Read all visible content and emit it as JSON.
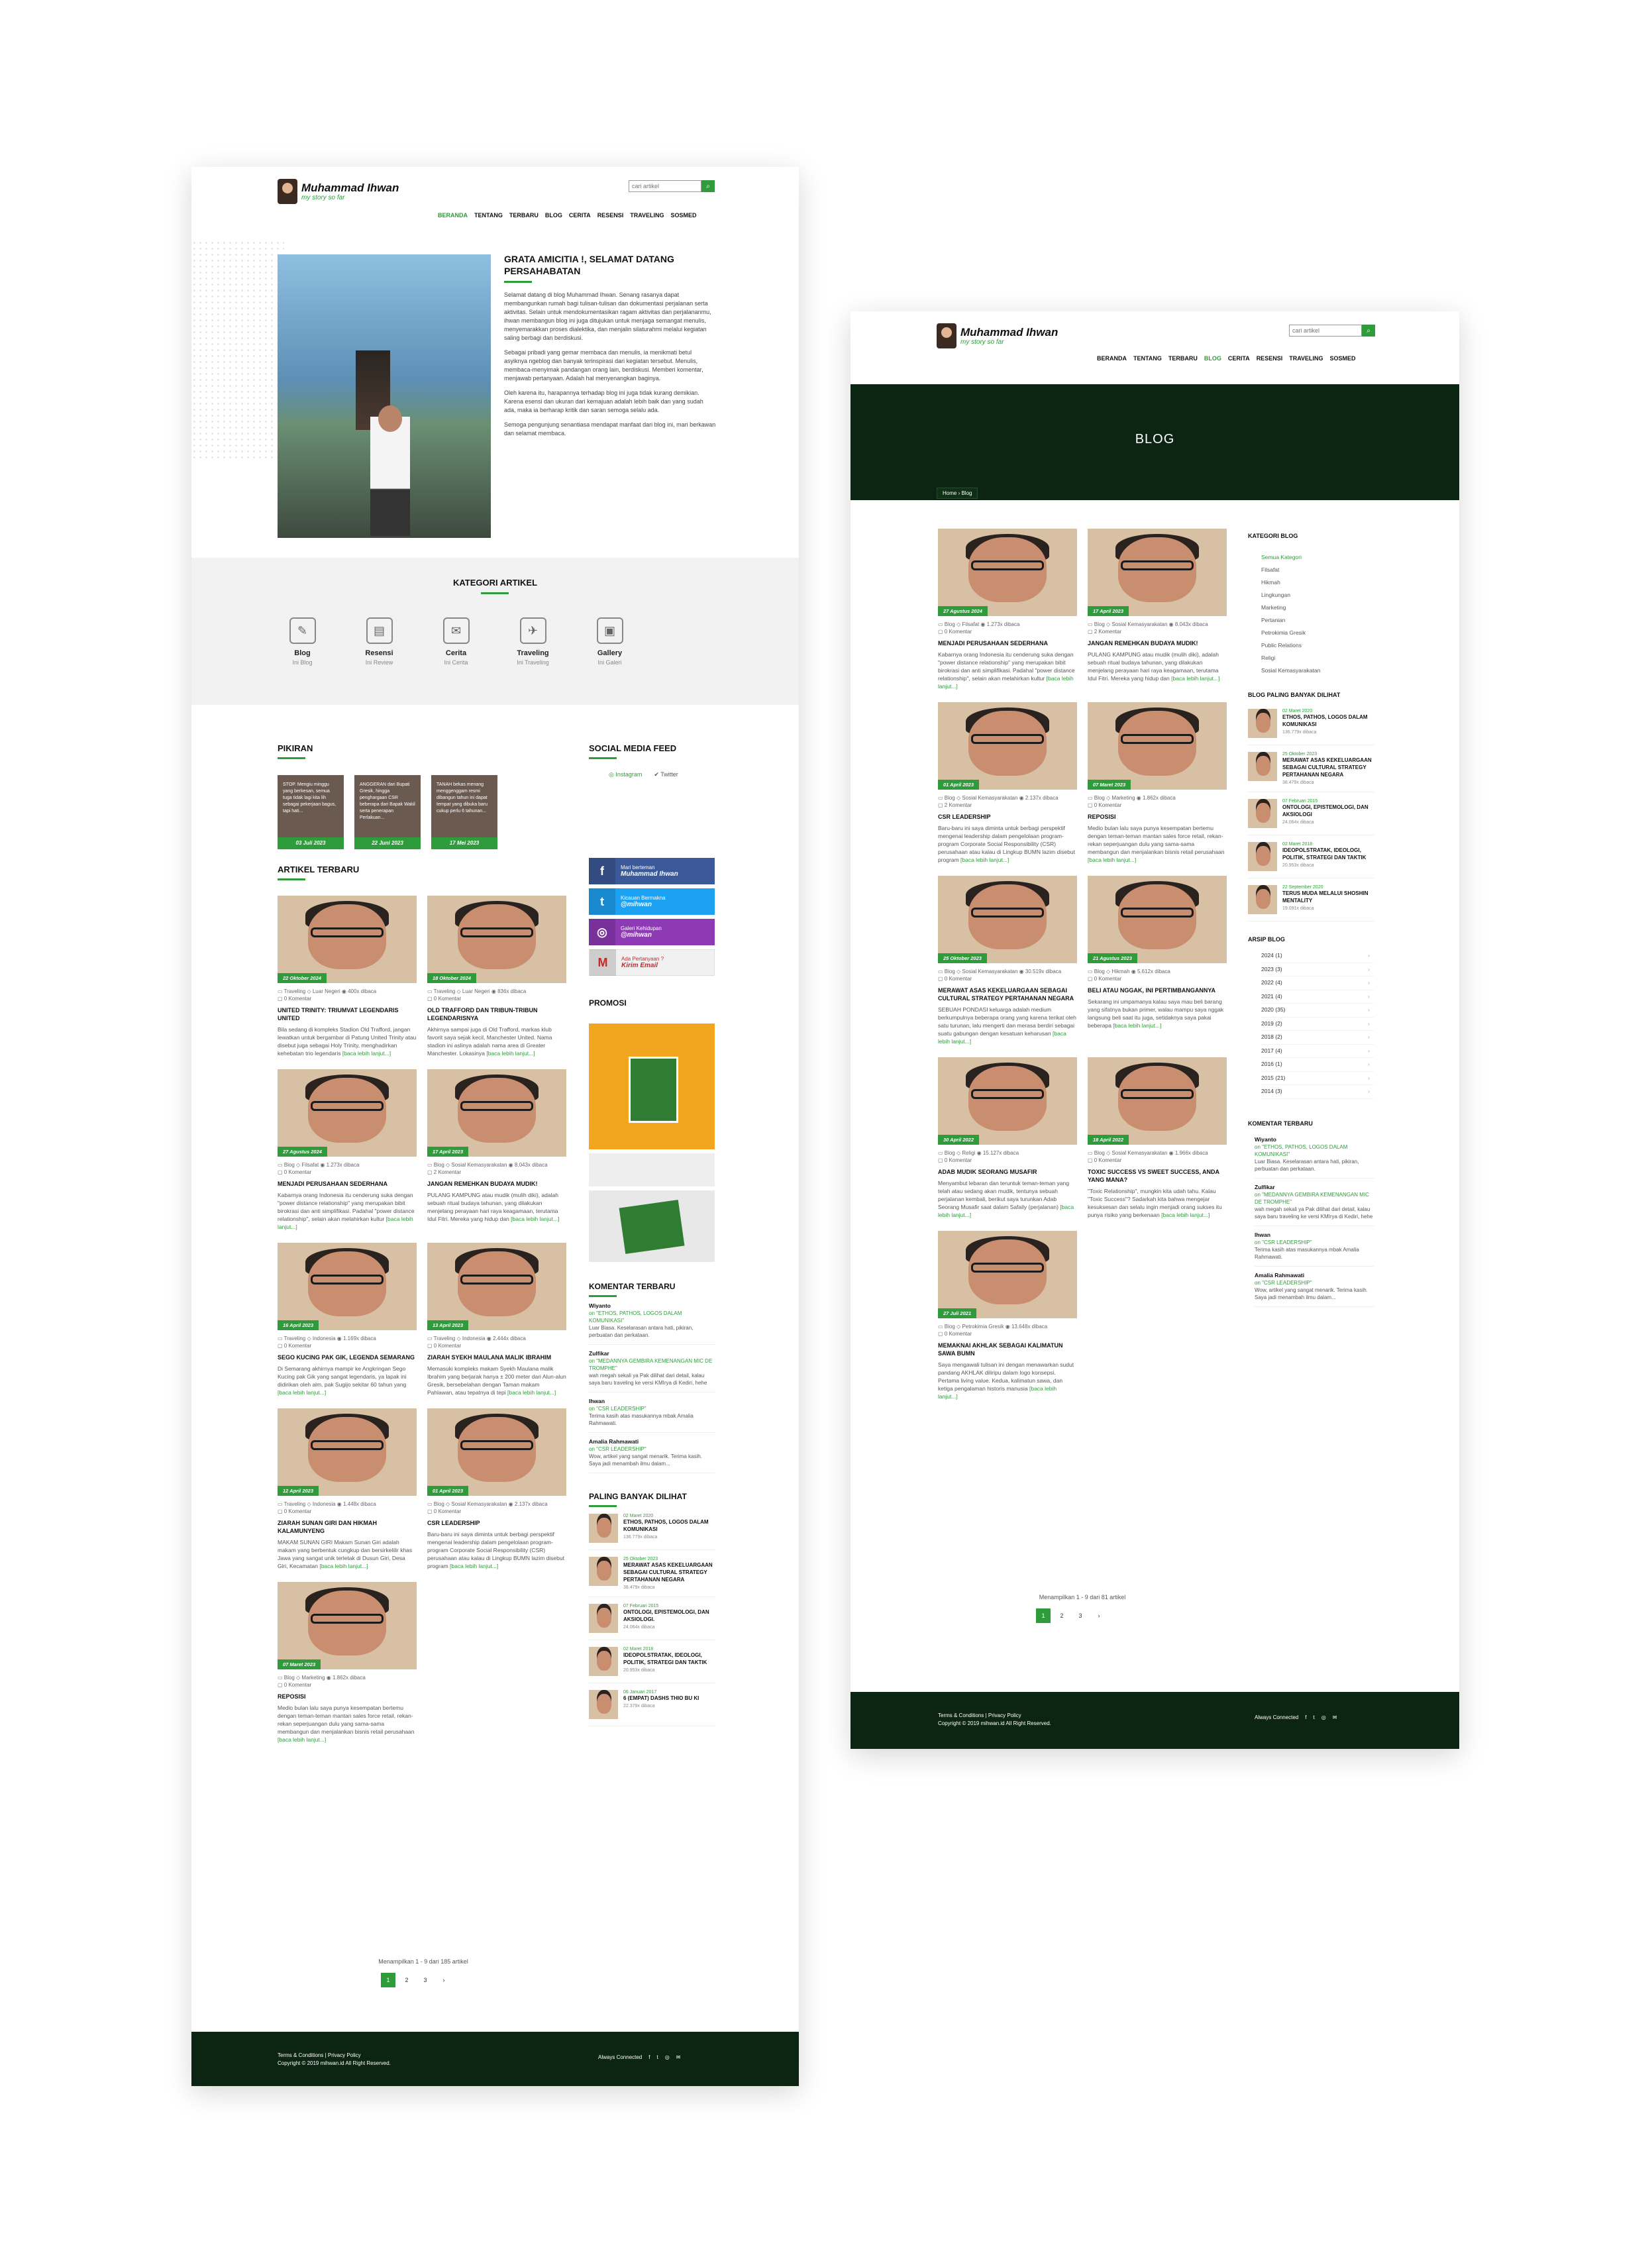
{
  "site": {
    "name": "Muhammad Ihwan",
    "tagline": "my story so far",
    "search_placeholder": "cari artikel",
    "nav": [
      "BERANDA",
      "TENTANG",
      "TERBARU",
      "BLOG",
      "CERITA",
      "RESENSI",
      "TRAVELING",
      "SOSMED"
    ]
  },
  "home": {
    "intro_title": "GRATA AMICITIA !, SELAMAT DATANG PERSAHABATAN",
    "intro_paras": [
      "Selamat datang di blog Muhammad Ihwan. Senang rasanya dapat membangunkan rumah bagi tulisan-tulisan dan dokumentasi perjalanan serta aktivitas. Selain untuk mendokumentasikan ragam aktivitas dan perjalananmu, ihwan membangun blog ini juga ditujukan untuk menjaga semangat menulis, menyemarakkan proses dialektika, dan menjalin silaturahmi melalui kegiatan saling berbagi dan berdiskusi.",
      "Sebagai pribadi yang gemar membaca dan menulis, ia menikmati betul asyiknya ngeblog dan banyak terinspirasi dari kegiatan tersebut. Menulis, membaca-menyimak pandangan orang lain, berdiskusi. Memberi komentar, menjawab pertanyaan. Adalah hal menyenangkan baginya.",
      "Oleh karena itu, harapannya terhadap blog ini juga tidak kurang demikian. Karena esensi dan ukuran dari kemajuan adalah lebih baik dan yang sudah ada, maka ia berharap kritik dan saran semoga selalu ada.",
      "Semoga pengunjung senantiasa mendapat manfaat dari blog ini, mari berkawan dan selamat membaca."
    ],
    "kategori_title": "KATEGORI ARTIKEL",
    "kategori": [
      {
        "t": "Blog",
        "s": "Ini Blog"
      },
      {
        "t": "Resensi",
        "s": "Ini Review"
      },
      {
        "t": "Cerita",
        "s": "Ini Cerita"
      },
      {
        "t": "Traveling",
        "s": "Ini Traveling"
      },
      {
        "t": "Gallery",
        "s": "Ini Galeri"
      }
    ],
    "pikiran_title": "PIKIRAN",
    "pikiran": [
      {
        "text": "STOP. Mengiu minggu yang berkesan, semua tuga tidak lagi kita lih sebagai pekerjaan bagus, tapi hati...",
        "date": "03 Juli 2023"
      },
      {
        "text": "ANGGERAN dari Bupati Gresik, hingga penghargaan CSR beberapa dari Bapak Wakil serta penerapan Perlakuan...",
        "date": "22 Juni 2023"
      },
      {
        "text": "TANAH bekas menang menggenggam resmi dibangun tahun ini dapat tempat yang dibuka baru cukup perlu 6 tahunan...",
        "date": "17 Mei 2023"
      }
    ],
    "artikel_title": "ARTIKEL TERBARU",
    "articles": [
      {
        "date": "22 Oktober 2024",
        "cat": "Traveling",
        "sub": "Luar Negeri",
        "views": "400x dibaca",
        "com": "0 Komentar",
        "title": "UNITED TRINITY: TRIUMVAT LEGENDARIS UNITED",
        "ex": "Bila sedang di kompleks Stadion Old Trafford, jangan lewatkan untuk bergambar di Patung United Trinity atau disebut juga sebagai Holy Trinity, menghadirkan kehebatan trio legendaris"
      },
      {
        "date": "18 Oktober 2024",
        "cat": "Traveling",
        "sub": "Luar Negeri",
        "views": "836x dibaca",
        "com": "0 Komentar",
        "title": "OLD TRAFFORD DAN TRIBUN-TRIBUN LEGENDARISNYA",
        "ex": "Akhirnya sampai juga di Old Trafford, markas klub favorit saya sejak kecil, Manchester United. Nama stadion ini aslinya adalah nama area di Greater Manchester. Lokasinya"
      },
      {
        "date": "27 Agustus 2024",
        "cat": "Blog",
        "sub": "Filsafat",
        "views": "1.273x dibaca",
        "com": "0 Komentar",
        "title": "MENJADI PERUSAHAAN SEDERHANA",
        "ex": "Kabarnya orang Indonesia itu cenderung suka dengan \"power distance relationship\" yang merupakan bibit birokrasi dan anti simplifikasi. Padahal \"power distance relationship\", selain akan melahirkan kultur"
      },
      {
        "date": "17 April 2023",
        "cat": "Blog",
        "sub": "Sosial Kemasyarakatan",
        "views": "8.043x dibaca",
        "com": "2 Komentar",
        "title": "JANGAN REMEHKAN BUDAYA MUDIK!",
        "ex": "PULANG KAMPUNG atau mudik (mulih diki), adalah sebuah ritual budaya tahunan, yang dilakukan menjelang perayaan hari raya keagamaan, terutama Idul Fitri. Mereka yang hidup dan"
      },
      {
        "date": "16 April 2023",
        "cat": "Traveling",
        "sub": "Indonesia",
        "views": "1.169x dibaca",
        "com": "0 Komentar",
        "title": "SEGO KUCING PAK GIK, LEGENDA SEMARANG",
        "ex": "Di Semarang akhirnya mampir ke Angkringan Sego Kucing pak Gik yang sangat legendaris, ya lapak ini didirikan oleh alm. pak Sugijo sekitar 60 tahun yang"
      },
      {
        "date": "13 April 2023",
        "cat": "Traveling",
        "sub": "Indonesia",
        "views": "2.444x dibaca",
        "com": "0 Komentar",
        "title": "ZIARAH SYEKH MAULANA MALIK IBRAHIM",
        "ex": "Memasuki kompleks makam Syekh Maulana malik Ibrahim yang berjarak hanya ± 200 meter dari Alun-alun Gresik, bersebelahan dengan Taman makam Pahlawan, atau tepatnya di tepi"
      },
      {
        "date": "12 April 2023",
        "cat": "Traveling",
        "sub": "Indonesia",
        "views": "1.448x dibaca",
        "com": "0 Komentar",
        "title": "ZIARAH SUNAN GIRI DAN HIKMAH KALAMUNYENG",
        "ex": "MAKAM SUNAN GIRI Makam Sunan Giri adalah makam yang berbentuk cungkup dan bersirkelilir khas Jawa yang sangat unik terletak di Dusun Giri, Desa Giri, Kecamatan"
      },
      {
        "date": "01 April 2023",
        "cat": "Blog",
        "sub": "Sosial Kemasyarakatan",
        "views": "2.137x dibaca",
        "com": "0 Komentar",
        "title": "CSR LEADERSHIP",
        "ex": "Baru-baru ini saya diminta untuk berbagi perspektif mengenai leadership dalam pengelolaan program-program Corporate Social Responsibility (CSR) perusahaan atau kalau di Lingkup BUMN lazim disebut program"
      },
      {
        "date": "07 Maret 2023",
        "cat": "Blog",
        "sub": "Marketing",
        "views": "1.862x dibaca",
        "com": "0 Komentar",
        "title": "REPOSISI",
        "ex": "Medio bulan lalu saya punya kesempatan bertemu dengan teman-teman mantan sales force retail, rekan-rekan seperjuangan dulu yang sama-sama membangun dan menjalankan bisnis retail perusahaan"
      }
    ],
    "more": "[baca lebih lanjut...]",
    "showing": "Menampilkan 1 - 9 dari 185 artikel",
    "pages": [
      "1",
      "2",
      "3",
      "›"
    ],
    "smf_title": "SOCIAL MEDIA FEED",
    "smf_tabs": [
      "Instagram",
      "Twitter"
    ],
    "social": [
      {
        "icon": "f",
        "l1": "Mari berteman",
        "l2": "Muhammad Ihwan",
        "color": "#3b5998"
      },
      {
        "icon": "t",
        "l1": "Kicauan Bermakna",
        "l2": "@mihwan",
        "color": "#1da1f2"
      },
      {
        "icon": "◎",
        "l1": "Galeri Kehidupan",
        "l2": "@mihwan",
        "color": "#8e3ab5"
      },
      {
        "icon": "M",
        "l1": "Ada Pertanyaan ?",
        "l2": "Kirim Email",
        "color": "#f1f1f1"
      }
    ],
    "promosi_title": "PROMOSI",
    "komentar_title": "KOMENTAR TERBARU",
    "komentar": [
      {
        "n": "Wiyanto",
        "on": "on \"ETHOS, PATHOS, LOGOS DALAM KOMUNIKASI\"",
        "t": "Luar Biasa. Keselarasan antara hati, pikiran, perbuatan dan perkataan."
      },
      {
        "n": "Zulfikar",
        "on": "on \"MEDANNYA GEMBIRA KEMENANGAN MIC DE TROMPHE\"",
        "t": "wah megah sekali ya Pak dilihat dari detail, kalau saya baru traveling ke versi KMIrya di Kediri, hehe"
      },
      {
        "n": "Ihwan",
        "on": "on \"CSR LEADERSHIP\"",
        "t": "Terima kasih atas masukannya mbak Amalia Rahmawati."
      },
      {
        "n": "Amalia Rahmawati",
        "on": "on \"CSR LEADERSHIP\"",
        "t": "Wow, artikel yang sangat menarik. Terima kasih. Saya jadi menambah ilmu dalam..."
      }
    ],
    "paling_title": "PALING BANYAK DILIHAT",
    "paling": [
      {
        "d": "02 Maret 2020",
        "t": "ETHOS, PATHOS, LOGOS DALAM KOMUNIKASI",
        "v": "136.779x dibaca"
      },
      {
        "d": "25 Oktober 2023",
        "t": "MERAWAT ASAS KEKELUARGAAN SEBAGAI CULTURAL STRATEGY PERTAHANAN NEGARA",
        "v": "38.479x dibaca"
      },
      {
        "d": "07 Februari 2015",
        "t": "ONTOLOGI, EPISTEMOLOGI, DAN AKSIOLOGI.",
        "v": "24.064x dibaca"
      },
      {
        "d": "02 Maret 2018",
        "t": "IDEOPOLSTRATAK, IDEOLOGI, POLITIK, STRATEGI DAN TAKTIK",
        "v": "20.953x dibaca"
      },
      {
        "d": "06 Januari 2017",
        "t": "6 (EMPAT) DASHS THIO BU KI",
        "v": "22.379x dibaca"
      }
    ]
  },
  "blog": {
    "banner": "BLOG",
    "crumb": "Home  ›  Blog",
    "articles": [
      {
        "date": "27 Agustus 2024",
        "cat": "Blog",
        "sub": "Filsafat",
        "views": "1.273x dibaca",
        "com": "0 Komentar",
        "title": "MENJADI PERUSAHAAN SEDERHANA",
        "ex": "Kabarnya orang Indonesia itu cenderung suka dengan \"power distance relationship\" yang merupakan bibit birokrasi dan anti simplifikasi. Padahal \"power distance relationship\", selain akan melahirkan kultur"
      },
      {
        "date": "17 April 2023",
        "cat": "Blog",
        "sub": "Sosial Kemasyarakatan",
        "views": "8.043x dibaca",
        "com": "2 Komentar",
        "title": "JANGAN REMEHKAN BUDAYA MUDIK!",
        "ex": "PULANG KAMPUNG atau mudik (mulih diki), adalah sebuah ritual budaya tahunan, yang dilakukan menjelang perayaan hari raya keagamaan, terutama Idul Fitri. Mereka yang hidup dan"
      },
      {
        "date": "01 April 2023",
        "cat": "Blog",
        "sub": "Sosial Kemasyarakatan",
        "views": "2.137x dibaca",
        "com": "2 Komentar",
        "title": "CSR LEADERSHIP",
        "ex": "Baru-baru ini saya diminta untuk berbagi perspektif mengenai leadership dalam pengelolaan program-program Corporate Social Responsibility (CSR) perusahaan atau kalau di Lingkup BUMN lazim disebut program"
      },
      {
        "date": "07 Maret 2023",
        "cat": "Blog",
        "sub": "Marketing",
        "views": "1.862x dibaca",
        "com": "0 Komentar",
        "title": "REPOSISI",
        "ex": "Medio bulan lalu saya punya kesempatan bertemu dengan teman-teman mantan sales force retail, rekan-rekan seperjuangan dulu yang sama-sama membangun dan menjalankan bisnis retail perusahaan"
      },
      {
        "date": "25 Oktober 2023",
        "cat": "Blog",
        "sub": "Sosial Kemasyarakatan",
        "views": "30.519x dibaca",
        "com": "0 Komentar",
        "title": "MERAWAT ASAS KEKELUARGAAN SEBAGAI CULTURAL STRATEGY PERTAHANAN NEGARA",
        "ex": "SEBUAH PONDASI keluarga adalah medium berkumpulnya beberapa orang yang karena terikat oleh satu turunan, lalu mengerti dan merasa berdiri sebagai suatu gabungan dengan kesatuan keharusan"
      },
      {
        "date": "21 Agustus 2023",
        "cat": "Blog",
        "sub": "Hikmah",
        "views": "5.612x dibaca",
        "com": "0 Komentar",
        "title": "BELI ATAU NGGAK, INI PERTIMBANGANNYA",
        "ex": "Sekarang ini umpamanya kalau saya mau beli barang yang sifatnya bukan primer, walau mampu saya nggak langsung beli saat itu juga, setidaknya saya pakai beberapa"
      },
      {
        "date": "30 April 2022",
        "cat": "Blog",
        "sub": "Religi",
        "views": "15.127x dibaca",
        "com": "0 Komentar",
        "title": "ADAB MUDIK SEORANG MUSAFIR",
        "ex": "Menyambut lebaran dan teruntuk teman-teman yang telah atau sedang akan mudik, tentunya sebuah perjalanan kembali, berikut saya turunkan Adab Seorang Musafir saat dalam Safaily (perjalanan)"
      },
      {
        "date": "18 April 2022",
        "cat": "Blog",
        "sub": "Sosial Kemasyarakatan",
        "views": "1.966x dibaca",
        "com": "0 Komentar",
        "title": "TOXIC SUCCESS VS SWEET SUCCESS, ANDA YANG MANA?",
        "ex": "\"Toxic Relationship\", mungkin kita udah tahu. Kalau \"Toxic Success\"? Sadarkah kita bahwa mengejar kesuksesan dan selalu ingin menjadi orang sukses itu punya risiko yang berkenaan"
      },
      {
        "date": "27 Juli 2021",
        "cat": "Blog",
        "sub": "Petrokimia Gresik",
        "views": "13.648x dibaca",
        "com": "0 Komentar",
        "title": "MEMAKNAI AKHLAK SEBAGAI KALIMATUN SAWA BUMN",
        "ex": "Saya mengawali tulisan ini dengan menawarkan sudut pandang AKHLAK diliripu dalam logo konsepsi. Pertama living value. Kedua, kalimatun sawa, dan ketiga pengalaman historis manusia"
      }
    ],
    "showing": "Menampilkan 1 - 9 dari 81 artikel",
    "kategori_title": "KATEGORI BLOG",
    "kategori": [
      "Semua Kategori",
      "Filsafat",
      "Hikmah",
      "Lingkungan",
      "Marketing",
      "Pertanian",
      "Petrokimia Gresik",
      "Public Relations",
      "Religi",
      "Sosial Kemasyarakatan"
    ],
    "paling_title": "BLOG PALING BANYAK DILIHAT",
    "paling": [
      {
        "d": "02 Maret 2020",
        "t": "ETHOS, PATHOS, LOGOS DALAM KOMUNIKASI",
        "v": "136.779x dibaca"
      },
      {
        "d": "25 Oktober 2023",
        "t": "MERAWAT ASAS KEKELUARGAAN SEBAGAI CULTURAL STRATEGY PERTAHANAN NEGARA",
        "v": "38.479x dibaca"
      },
      {
        "d": "07 Februari 2015",
        "t": "ONTOLOGI, EPISTEMOLOGI, DAN AKSIOLOGI",
        "v": "24.064x dibaca"
      },
      {
        "d": "02 Maret 2018",
        "t": "IDEOPOLSTRATAK, IDEOLOGI, POLITIK, STRATEGI DAN TAKTIK",
        "v": "20.953x dibaca"
      },
      {
        "d": "22 September 2020",
        "t": "TERUS MUDA MELALUI SHOSHIN MENTALITY",
        "v": "19.091x dibaca"
      }
    ],
    "arsip_title": "ARSIP BLOG",
    "arsip": [
      "2024 (1)",
      "2023 (3)",
      "2022 (4)",
      "2021 (4)",
      "2020 (35)",
      "2019 (2)",
      "2018 (2)",
      "2017 (4)",
      "2016 (1)",
      "2015 (21)",
      "2014 (3)"
    ],
    "komentar_title": "KOMENTAR TERBARU"
  },
  "footer": {
    "links": "Terms & Conditions  |  Privacy Policy",
    "copy": "Copyright © 2019 mihwan.id All Right Reserved.",
    "connected": "Always Connected",
    "icons": [
      "f",
      "t",
      "◎",
      "✉"
    ]
  }
}
